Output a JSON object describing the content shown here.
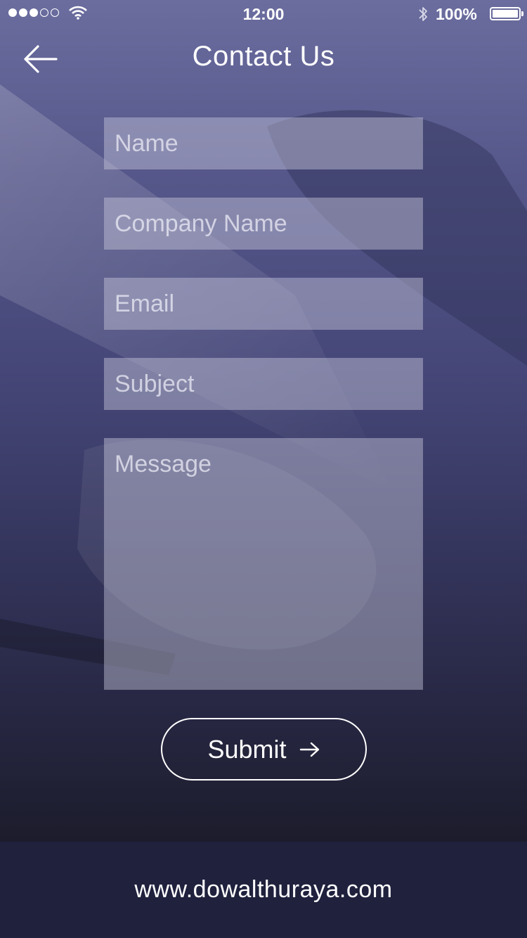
{
  "status_bar": {
    "signal_bars": 5,
    "signal_filled": 3,
    "time": "12:00",
    "battery_percent": "100%"
  },
  "header": {
    "title": "Contact Us",
    "back_icon": "arrow-left-icon"
  },
  "form": {
    "name_placeholder": "Name",
    "company_placeholder": "Company Name",
    "email_placeholder": "Email",
    "subject_placeholder": "Subject",
    "message_placeholder": "Message",
    "submit_label": "Submit",
    "submit_icon": "arrow-right-icon"
  },
  "footer": {
    "website": "www.dowalthuraya.com"
  },
  "colors": {
    "footer_background": "#1f213d",
    "text": "#ffffff"
  }
}
